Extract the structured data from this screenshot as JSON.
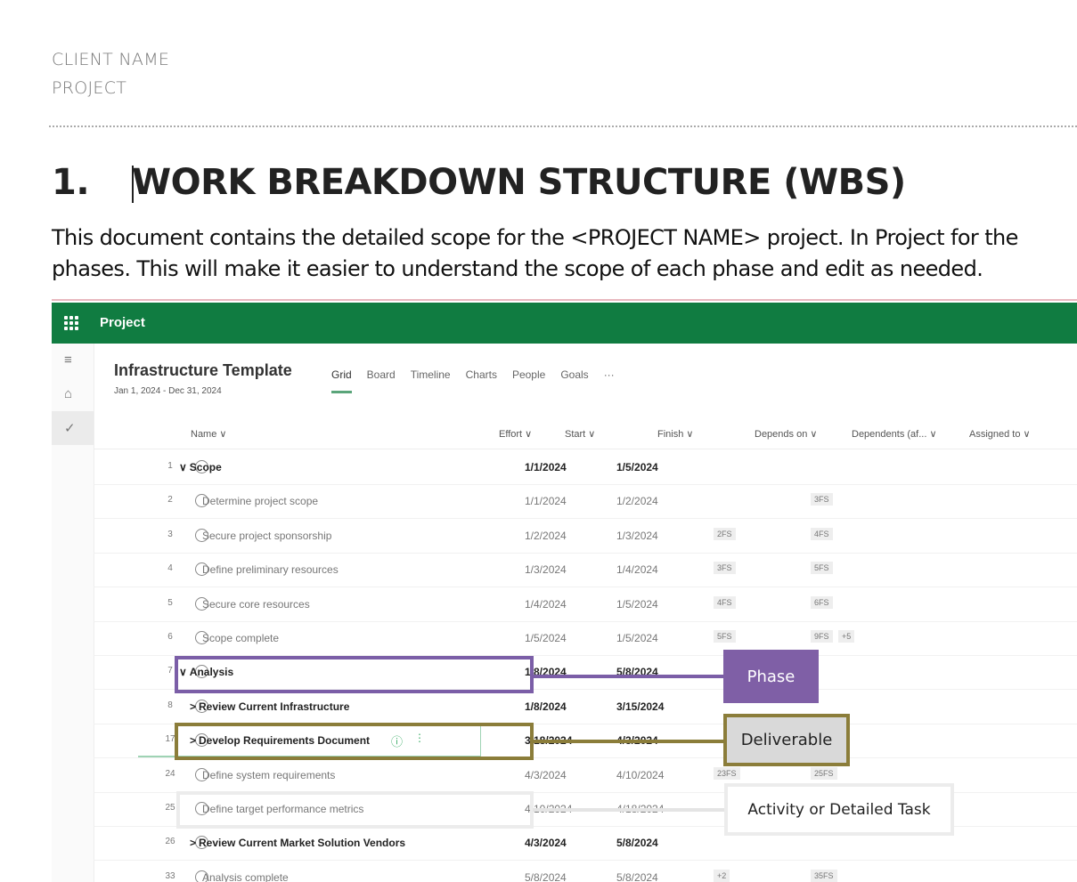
{
  "document": {
    "client_name": "CLIENT NAME",
    "project": "PROJECT",
    "heading_number": "1.",
    "heading": "WORK BREAKDOWN STRUCTURE (WBS)",
    "paragraph_line1": "This document contains the detailed scope for the <PROJECT NAME> project.   In Project for the",
    "paragraph_line2": "phases.   This will make it easier to understand the scope of each phase and edit as needed."
  },
  "app": {
    "name": "Project",
    "brand_color": "#107c41",
    "plan_title": "Infrastructure Template",
    "date_range": "Jan 1, 2024 - Dec 31, 2024",
    "tabs": [
      "Grid",
      "Board",
      "Timeline",
      "Charts",
      "People",
      "Goals",
      "···"
    ],
    "active_tab": "Grid",
    "columns": {
      "name": "Name ∨",
      "effort": "Effort ∨",
      "start": "Start ∨",
      "finish": "Finish ∨",
      "depends_on": "Depends on ∨",
      "dependents": "Dependents (af... ∨",
      "assigned_to": "Assigned to ∨"
    },
    "rows": [
      {
        "num": "1",
        "name": "Scope",
        "level": 0,
        "bold": true,
        "toggle": "∨",
        "start": "1/1/2024",
        "finish": "1/5/2024",
        "depends": "",
        "dependents": "",
        "extra": ""
      },
      {
        "num": "2",
        "name": "Determine project scope",
        "level": 2,
        "bold": false,
        "toggle": "",
        "start": "1/1/2024",
        "finish": "1/2/2024",
        "depends": "",
        "dependents": "3FS",
        "extra": ""
      },
      {
        "num": "3",
        "name": "Secure project sponsorship",
        "level": 2,
        "bold": false,
        "toggle": "",
        "start": "1/2/2024",
        "finish": "1/3/2024",
        "depends": "2FS",
        "dependents": "4FS",
        "extra": ""
      },
      {
        "num": "4",
        "name": "Define preliminary resources",
        "level": 2,
        "bold": false,
        "toggle": "",
        "start": "1/3/2024",
        "finish": "1/4/2024",
        "depends": "3FS",
        "dependents": "5FS",
        "extra": ""
      },
      {
        "num": "5",
        "name": "Secure core resources",
        "level": 2,
        "bold": false,
        "toggle": "",
        "start": "1/4/2024",
        "finish": "1/5/2024",
        "depends": "4FS",
        "dependents": "6FS",
        "extra": ""
      },
      {
        "num": "6",
        "name": "Scope complete",
        "level": 2,
        "bold": false,
        "toggle": "",
        "start": "1/5/2024",
        "finish": "1/5/2024",
        "depends": "5FS",
        "dependents": "9FS",
        "extra": "+5"
      },
      {
        "num": "7",
        "name": "Analysis",
        "level": 0,
        "bold": true,
        "toggle": "∨",
        "start": "1/8/2024",
        "finish": "5/8/2024",
        "depends": "",
        "dependents": "",
        "extra": ""
      },
      {
        "num": "8",
        "name": "Review Current Infrastructure",
        "level": 1,
        "bold": true,
        "toggle": ">",
        "start": "1/8/2024",
        "finish": "3/15/2024",
        "depends": "",
        "dependents": "",
        "extra": ""
      },
      {
        "num": "17",
        "name": "Develop Requirements Document",
        "level": 1,
        "bold": true,
        "toggle": ">",
        "start": "3/18/2024",
        "finish": "4/3/2024",
        "depends": "",
        "dependents": "",
        "extra": ""
      },
      {
        "num": "24",
        "name": "Define system requirements",
        "level": 2,
        "bold": false,
        "toggle": "",
        "start": "4/3/2024",
        "finish": "4/10/2024",
        "depends": "23FS",
        "dependents": "25FS",
        "extra": ""
      },
      {
        "num": "25",
        "name": "Define target performance metrics",
        "level": 2,
        "bold": false,
        "toggle": "",
        "start": "4/10/2024",
        "finish": "4/18/2024",
        "depends": "",
        "dependents": "",
        "extra": ""
      },
      {
        "num": "26",
        "name": "Review Current Market Solution Vendors",
        "level": 1,
        "bold": true,
        "toggle": ">",
        "start": "4/3/2024",
        "finish": "5/8/2024",
        "depends": "",
        "dependents": "",
        "extra": ""
      },
      {
        "num": "33",
        "name": "Analysis complete",
        "level": 2,
        "bold": false,
        "toggle": "",
        "start": "5/8/2024",
        "finish": "5/8/2024",
        "depends": "+2",
        "dependents": "35FS",
        "extra": ""
      }
    ]
  },
  "annotations": {
    "phase": {
      "label": "Phase",
      "color": "#7b5ea7"
    },
    "deliverable": {
      "label": "Deliverable",
      "color": "#8b7d3a"
    },
    "activity": {
      "label": "Activity or Detailed Task",
      "color": "#ececec"
    }
  }
}
